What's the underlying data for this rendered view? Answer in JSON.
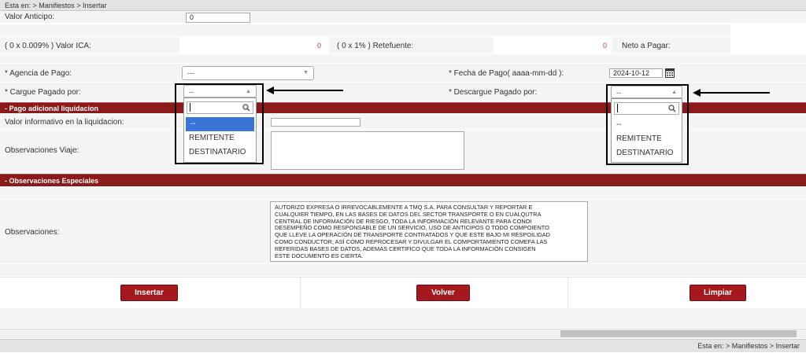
{
  "breadcrumb": "Esta en: > Manifiestos > Insertar",
  "anticipo": {
    "label": "Valor Anticipo:",
    "value": "0"
  },
  "taxes": {
    "ica_label": "( 0 x 0.009% ) Valor ICA:",
    "ica_value": "0",
    "retefuente_label": "( 0 x 1% ) Retefuente:",
    "retefuente_value": "0",
    "neto_label": "Neto a Pagar:"
  },
  "agencia": {
    "label": "* Agencia de Pago:",
    "selected": "---"
  },
  "fecha_pago": {
    "label": "* Fecha de Pago( aaaa-mm-dd ):",
    "value": "2024-10-12"
  },
  "cargue": {
    "label": "* Cargue Pagado por:",
    "selected": "--",
    "options": [
      "--",
      "REMITENTE",
      "DESTINATARIO"
    ]
  },
  "descargue": {
    "label": "* Descargue Pagado por:",
    "selected": "--",
    "options": [
      "--",
      "REMITENTE",
      "DESTINATARIO"
    ]
  },
  "section_pago": "- Pago adicional liquidacion",
  "valor_informativo_label": "Valor informativo en la liquidacion:",
  "obs_viaje_label": "Observaciones Viaje:",
  "section_obs": "- Observaciones Especiales",
  "observaciones": {
    "label": "Observaciones:",
    "text": "AUTORIZO EXPRESA O IRREVOCABLEMENTE A TMQ S.A. PARA CONSULTAR Y REPORTAR E\nCUALQUIER TIEMPO, EN LAS BASES DE DATOS DEL SECTOR TRANSPORTE O EN CUALQUTRA\nCENTRAL DE INFORMACIÓN DE RIESGO, TODA LA INFORMACIÓN RELEVANTE PARA CONOI\nDESEMPEÑO COMO RESPONSABLE DE UN SERVICIO, USO DE ANTICIPOS O TODO COMPOIENTO\nQUE LLEVE LA OPERACIÓN DE TRANSPORTE CONTRATADOS Y QUE ESTE BAJO MI RESPOILIDAD\nCOMO CONDUCTOR, ASÍ COMO REPROCESAR Y DIVULGAR EL COMPORTAMIENTO COMEFA LAS\nREFERIDAS BASES DE DATOS, ADEMAS CERTIFICO QUE TODA LA INFORMACIÓN CONSIGEN\nESTE DOCUMENTO ES CIERTA."
  },
  "buttons": {
    "insertar": "Insertar",
    "volver": "Volver",
    "limpiar": "Limpiar"
  },
  "footer_breadcrumb": "Esta en: > Manifiestos > Insertar",
  "icons": {
    "search": "search-icon",
    "calendar": "calendar-icon",
    "arrow": "left-arrow-annotation"
  },
  "colors": {
    "section_bg": "#8b1a1a",
    "button_bg": "#a5191e",
    "selected_option": "#3875d7",
    "value_red": "#c0392b"
  }
}
